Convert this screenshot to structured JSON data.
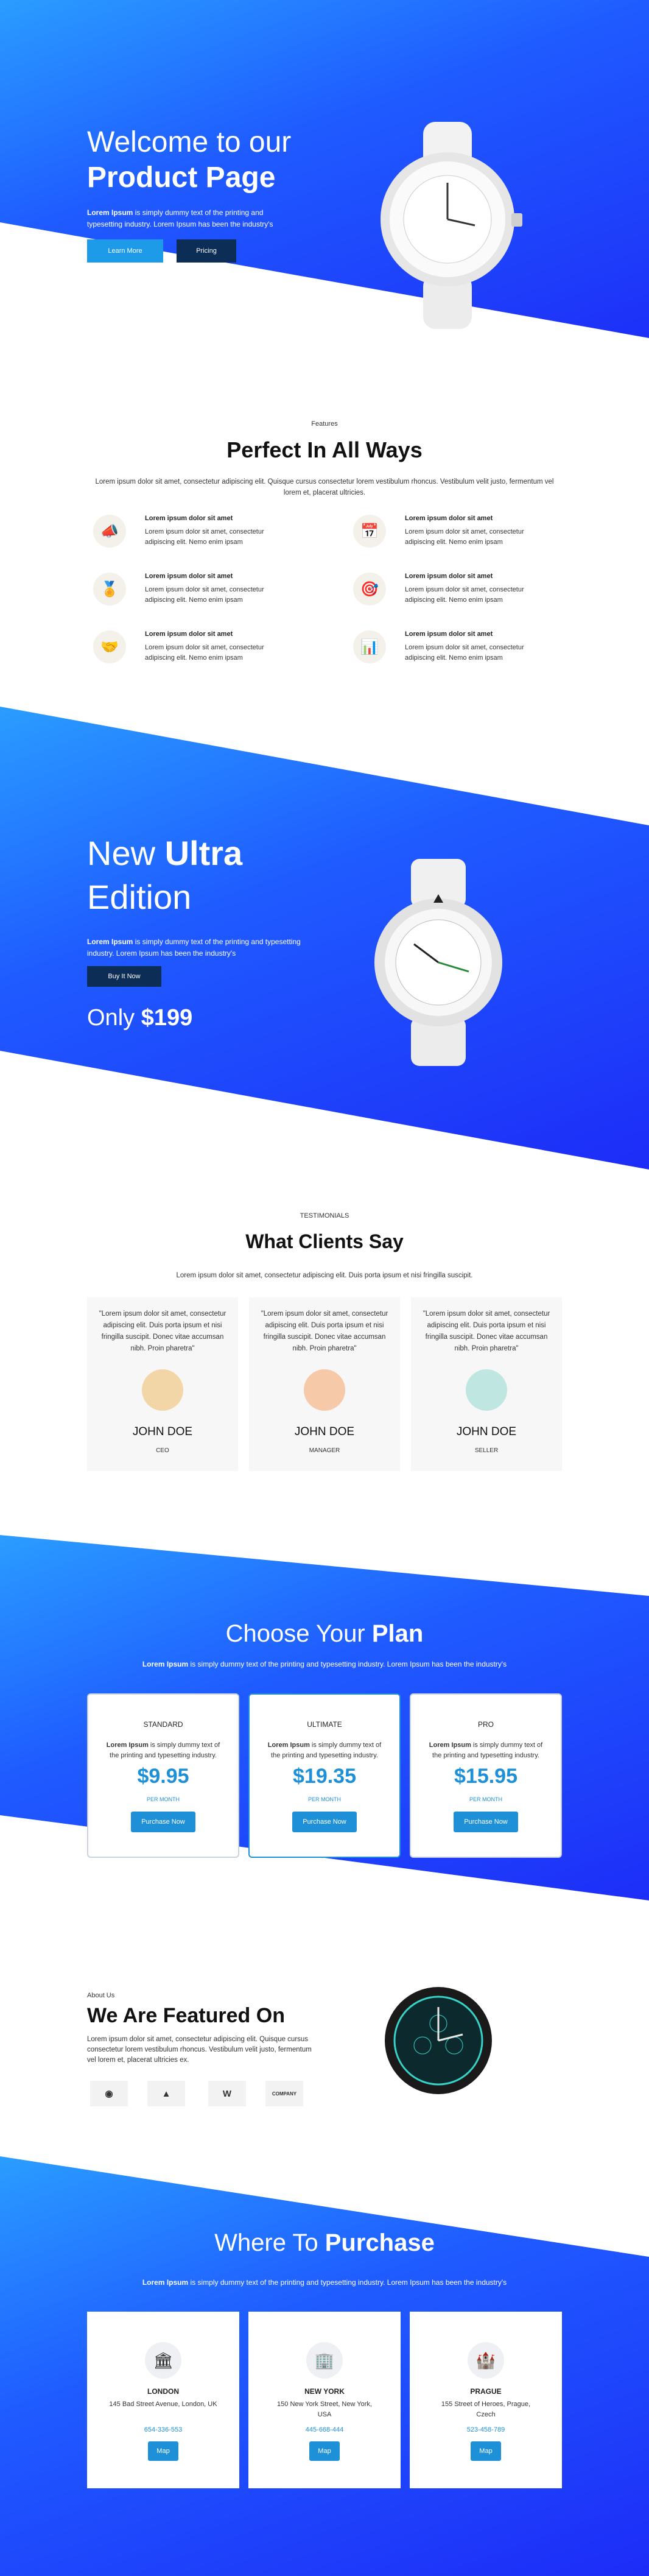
{
  "hero": {
    "title_light": "Welcome to our",
    "title_bold": "Product Page",
    "text_bold": "Lorem Ipsum",
    "text": " is simply dummy text of the printing and typesetting industry. Lorem Ipsum has been the industry's",
    "btn_learn": "Learn More",
    "btn_pricing": "Pricing"
  },
  "features": {
    "label": "Features",
    "title": "Perfect In All Ways",
    "desc": "Lorem ipsum dolor sit amet, consectetur adipiscing elit. Quisque cursus consectetur lorem vestibulum rhoncus. Vestibulum velit justo, fermentum vel lorem et, placerat ultricies.",
    "items": [
      {
        "title": "Lorem ipsum dolor sit amet",
        "text": "Lorem ipsum dolor sit amet, consectetur adipiscing elit. Nemo enim ipsam",
        "icon": "megaphone-icon"
      },
      {
        "title": "Lorem ipsum dolor sit amet",
        "text": "Lorem ipsum dolor sit amet, consectetur adipiscing elit. Nemo enim ipsam",
        "icon": "calendar-icon"
      },
      {
        "title": "Lorem ipsum dolor sit amet",
        "text": "Lorem ipsum dolor sit amet, consectetur adipiscing elit. Nemo enim ipsam",
        "icon": "medal-icon"
      },
      {
        "title": "Lorem ipsum dolor sit amet",
        "text": "Lorem ipsum dolor sit amet, consectetur adipiscing elit. Nemo enim ipsam",
        "icon": "target-icon"
      },
      {
        "title": "Lorem ipsum dolor sit amet",
        "text": "Lorem ipsum dolor sit amet, consectetur adipiscing elit. Nemo enim ipsam",
        "icon": "handshake-icon"
      },
      {
        "title": "Lorem ipsum dolor sit amet",
        "text": "Lorem ipsum dolor sit amet, consectetur adipiscing elit. Nemo enim ipsam",
        "icon": "chart-board-icon"
      }
    ]
  },
  "ultra": {
    "title_a": "New ",
    "title_b": "Ultra",
    "title_c": "Edition",
    "text_bold": "Lorem Ipsum",
    "text": " is simply dummy text of the printing and typesetting industry. Lorem Ipsum has been the industry's",
    "btn": "Buy It Now",
    "price_label": "Only ",
    "price": "$199"
  },
  "testimonials": {
    "label": "TESTIMONIALS",
    "title": "What Clients Say",
    "desc": "Lorem ipsum dolor sit amet, consectetur adipiscing elit. Duis porta ipsum et nisi fringilla suscipit.",
    "cards": [
      {
        "quote": "\"Lorem ipsum dolor sit amet, consectetur adipiscing elit. Duis porta ipsum et nisi fringilla suscipit. Donec vitae accumsan nibh. Proin pharetra\"",
        "name": "JOHN DOE",
        "role": "CEO"
      },
      {
        "quote": "\"Lorem ipsum dolor sit amet, consectetur adipiscing elit. Duis porta ipsum et nisi fringilla suscipit. Donec vitae accumsan nibh. Proin pharetra\"",
        "name": "JOHN DOE",
        "role": "MANAGER"
      },
      {
        "quote": "\"Lorem ipsum dolor sit amet, consectetur adipiscing elit. Duis porta ipsum et nisi fringilla suscipit. Donec vitae accumsan nibh. Proin pharetra\"",
        "name": "JOHN DOE",
        "role": "SELLER"
      }
    ]
  },
  "pricing": {
    "title_a": "Choose Your ",
    "title_b": "Plan",
    "desc_bold": "Lorem Ipsum",
    "desc": " is simply dummy text of the printing and typesetting industry. Lorem Ipsum has been the industry's",
    "plans": [
      {
        "name": "STANDARD",
        "text_bold": "Lorem Ipsum",
        "text": " is simply dummy text of the printing and typesetting industry.",
        "price": "$9.95",
        "period": "PER MONTH",
        "btn": "Purchase Now"
      },
      {
        "name": "ULTIMATE",
        "text_bold": "Lorem Ipsum",
        "text": " is simply dummy text of the printing and typesetting industry.",
        "price": "$19.35",
        "period": "PER MONTH",
        "btn": "Purchase Now"
      },
      {
        "name": "PRO",
        "text_bold": "Lorem Ipsum",
        "text": " is simply dummy text of the printing and typesetting industry.",
        "price": "$15.95",
        "period": "PER MONTH",
        "btn": "Purchase Now"
      }
    ]
  },
  "about": {
    "label": "About Us",
    "title": "We Are Featured On",
    "desc": "Lorem ipsum dolor sit amet, consectetur adipiscing elit. Quisque cursus consectetur lorem vestibulum rhoncus. Vestibulum velit justo, fermentum vel lorem et, placerat ultricies ex.",
    "logos": [
      "◉",
      "▲",
      "W",
      "COMPANY"
    ]
  },
  "locations": {
    "title_a": "Where To ",
    "title_b": "Purchase",
    "desc_bold": "Lorem Ipsum",
    "desc": " is simply dummy text of the printing and typesetting industry. Lorem Ipsum has been the industry's",
    "places": [
      {
        "city": "LONDON",
        "address": "145 Bad Street Avenue, London, UK",
        "phone": "654-336-553",
        "btn": "Map"
      },
      {
        "city": "NEW YORK",
        "address": "150 New York Street, New York, USA",
        "phone": "445-668-444",
        "btn": "Map"
      },
      {
        "city": "PRAGUE",
        "address": "155 Street of Heroes, Prague, Czech",
        "phone": "523-458-789",
        "btn": "Map"
      }
    ]
  },
  "colors": {
    "accent": "#1e90d8",
    "navy": "#0c2d55",
    "gradient_start": "#2a9dff",
    "gradient_end": "#1d2cf7"
  }
}
